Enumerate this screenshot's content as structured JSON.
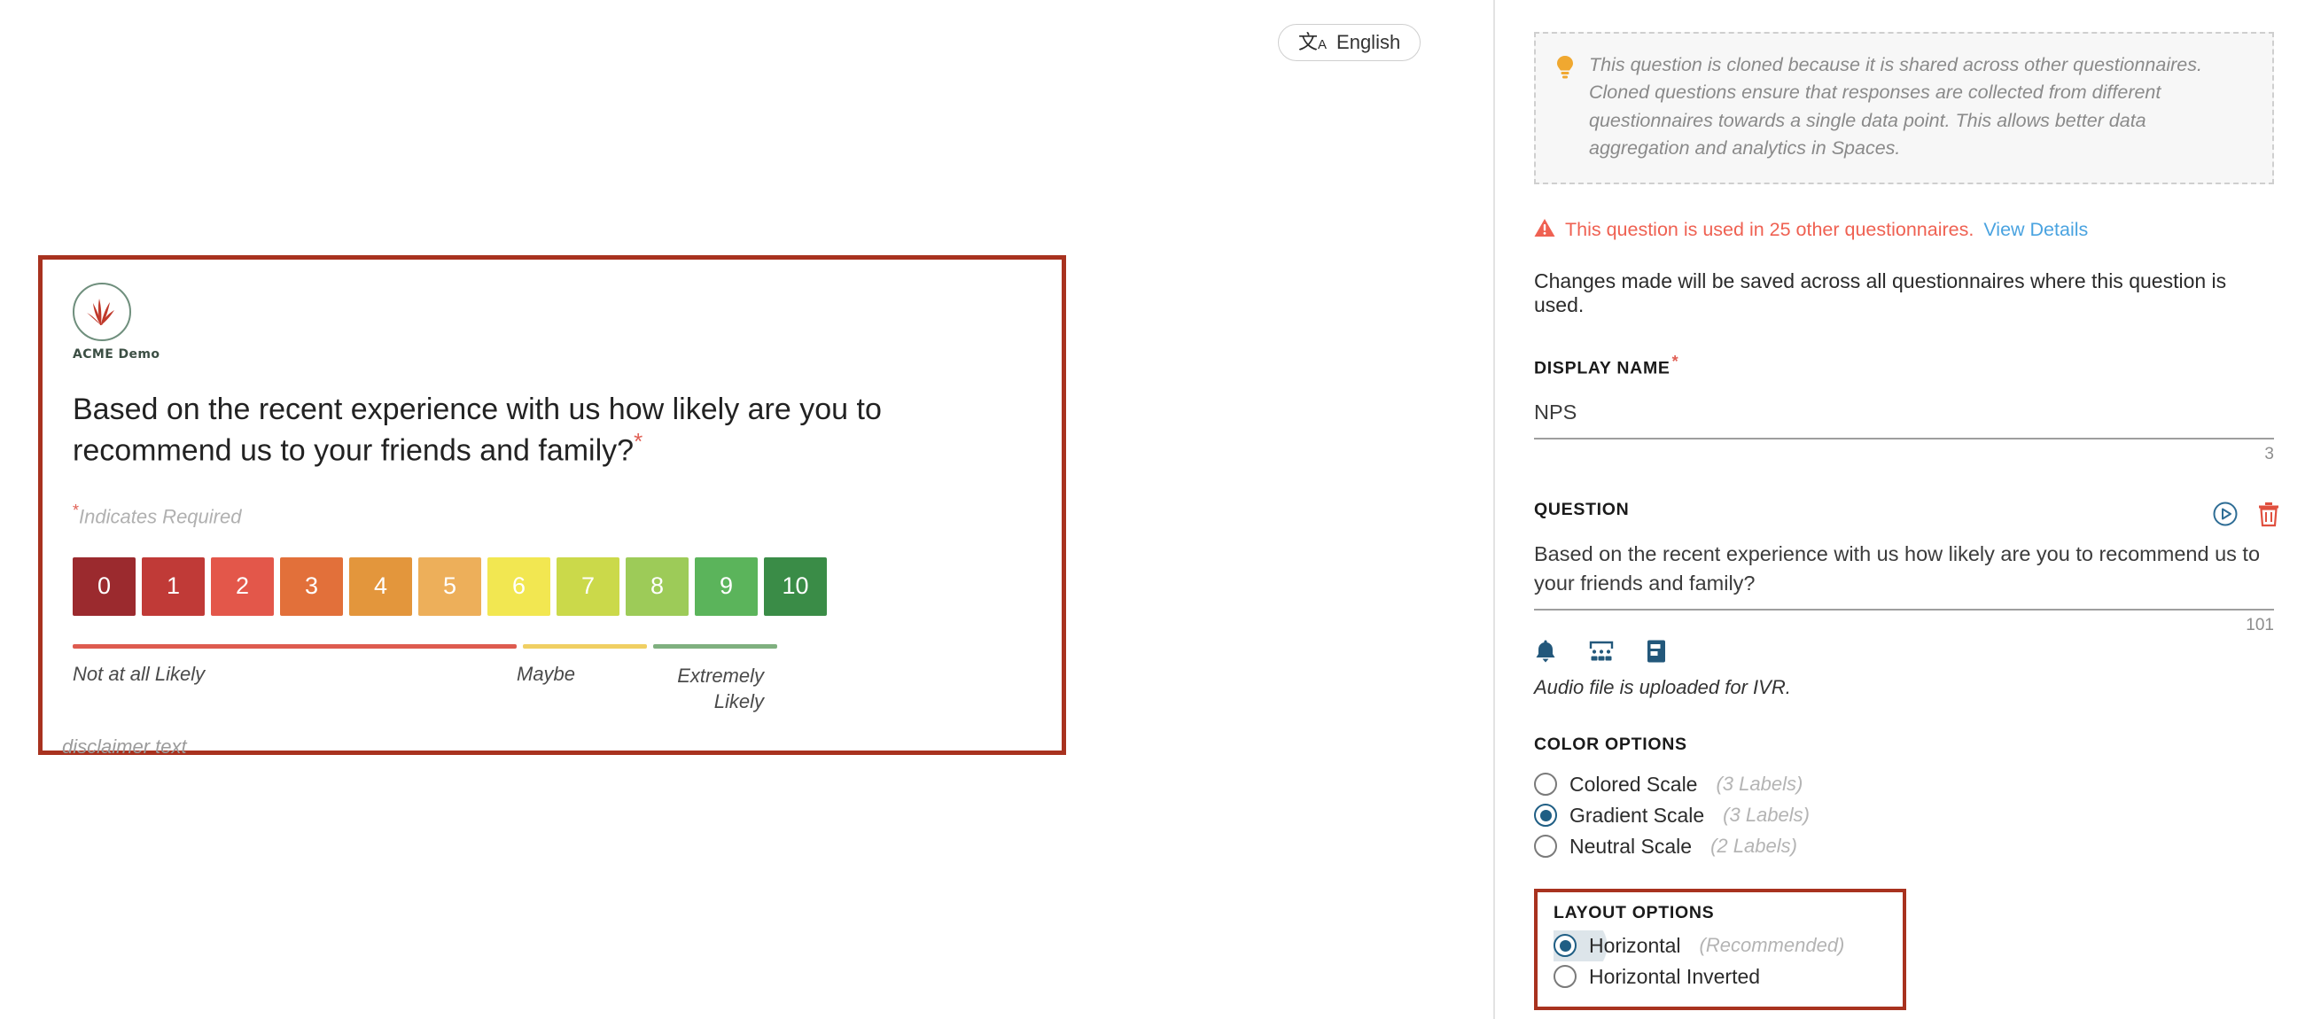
{
  "language_selector": {
    "icon": "translate-icon",
    "label": "English"
  },
  "preview": {
    "brand_name": "ACME Demo",
    "question_text": "Based on the recent experience with us how likely are you to recommend us to your friends and family?",
    "required_marker": "*",
    "required_note": "Indicates Required",
    "scale": {
      "values": [
        "0",
        "1",
        "2",
        "3",
        "4",
        "5",
        "6",
        "7",
        "8",
        "9",
        "10"
      ],
      "colors": [
        "#9b2a2e",
        "#c03a37",
        "#e3574a",
        "#e2703a",
        "#e3963c",
        "#edaf5a",
        "#f2e751",
        "#cbd94a",
        "#9dcb58",
        "#5bb45b",
        "#3a8c47"
      ]
    },
    "bars": {
      "detractor_color": "#de5b4f",
      "passive_color": "#f0cf63",
      "promoter_color": "#7fb07f"
    },
    "anchors": {
      "left": "Not at all Likely",
      "middle": "Maybe",
      "right": "Extremely Likely"
    },
    "disclaimer": "disclaimer text"
  },
  "panel": {
    "info_box": {
      "icon": "lightbulb-icon",
      "text": "This question is cloned because it is shared across other questionnaires. Cloned questions ensure that responses are collected from different questionnaires towards a single data point. This allows better data aggregation and analytics in Spaces."
    },
    "warning": {
      "icon": "warning-triangle-icon",
      "text": "This question is used in 25 other questionnaires.",
      "link_label": "View Details",
      "link_color": "#4aa3e0",
      "text_color": "#ef6152"
    },
    "note": "Changes made will be saved across all questionnaires where this question is used.",
    "display_name": {
      "label": "DISPLAY NAME",
      "required_marker": "*",
      "value": "NPS",
      "char_count": "3"
    },
    "question": {
      "label": "QUESTION",
      "value": "Based on the recent experience with us how likely are you to recommend us to your friends and family?",
      "char_count": "101",
      "actions": [
        {
          "name": "play-circle-icon",
          "color": "#2e6d95"
        },
        {
          "name": "delete-trash-icon",
          "color": "#e0503f"
        }
      ],
      "tool_icons": [
        {
          "name": "bell-icon"
        },
        {
          "name": "keypad-icon"
        },
        {
          "name": "form-icon"
        }
      ],
      "audio_note": "Audio file is uploaded for IVR."
    },
    "color_options": {
      "label": "COLOR OPTIONS",
      "items": [
        {
          "label": "Colored Scale",
          "hint": "(3 Labels)",
          "selected": false
        },
        {
          "label": "Gradient Scale",
          "hint": "(3 Labels)",
          "selected": true
        },
        {
          "label": "Neutral Scale",
          "hint": "(2 Labels)",
          "selected": false
        }
      ]
    },
    "layout_options": {
      "label": "LAYOUT OPTIONS",
      "highlight_color": "#a8321f",
      "items": [
        {
          "label": "Horizontal",
          "hint": "(Recommended)",
          "selected": true
        },
        {
          "label": "Horizontal Inverted",
          "hint": "",
          "selected": false
        }
      ]
    }
  }
}
